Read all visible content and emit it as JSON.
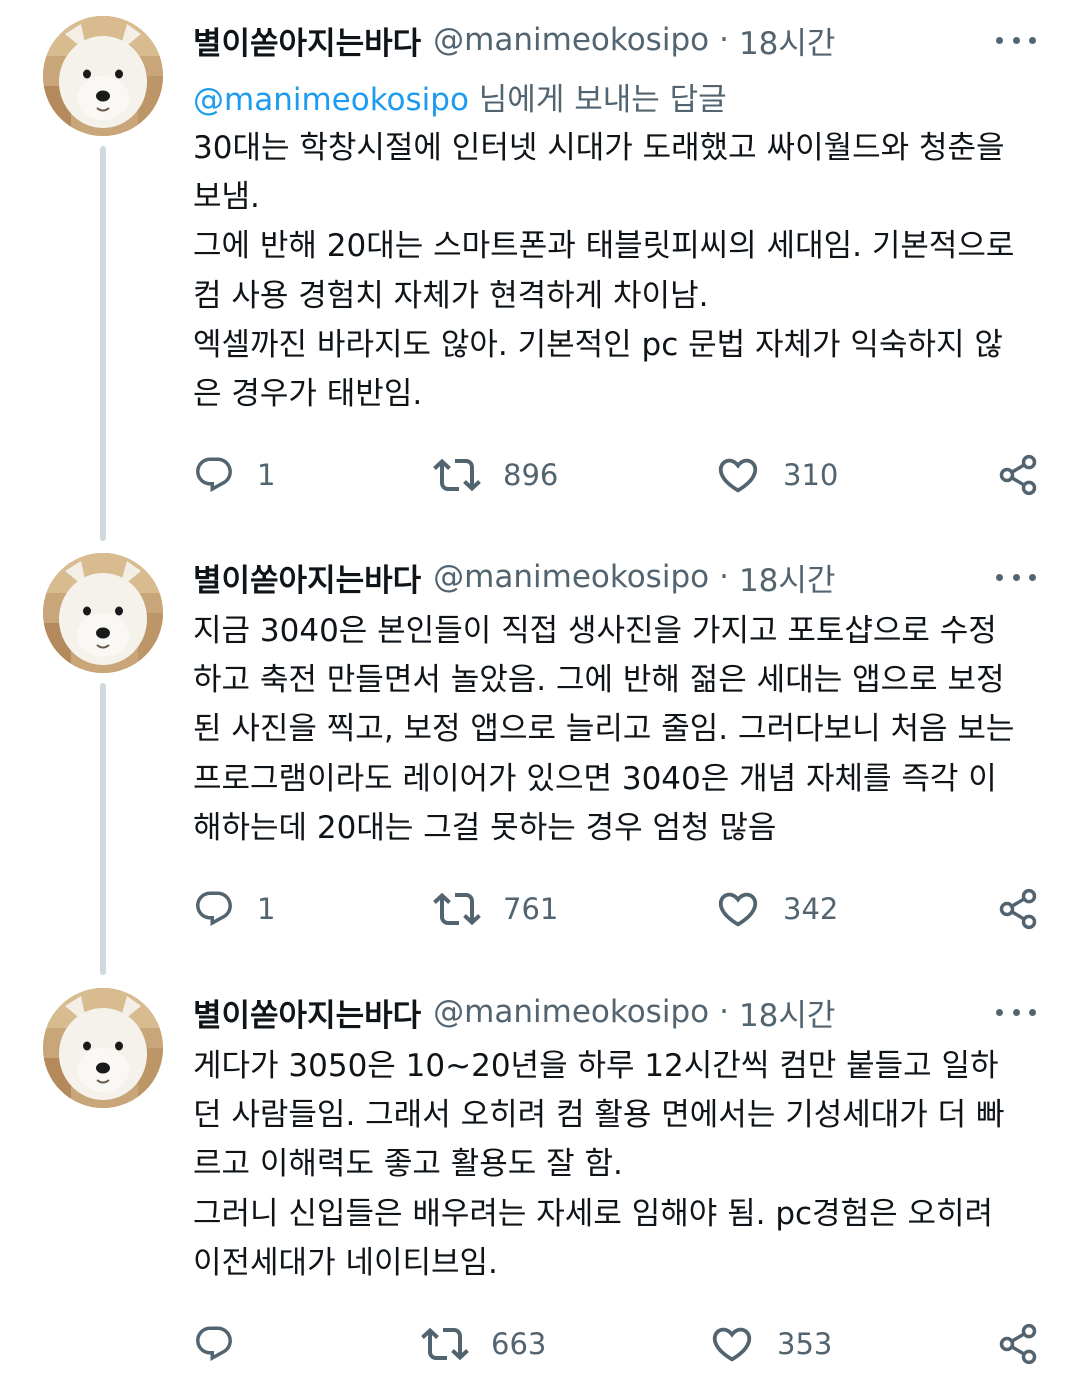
{
  "tweets": [
    {
      "name": "별이쏟아지는바다",
      "handle": "@manimeokosipo",
      "separator": "·",
      "time": "18시간",
      "reply_mention": "@manimeokosipo",
      "reply_suffix": " 님에게 보내는 답글",
      "lines": [
        "30대는 학창시절에 인터넷 시대가 도래했고 싸이월드와 청춘을",
        "보냄.",
        "그에 반해 20대는 스마트폰과 태블릿피씨의 세대임. 기본적으로",
        "컴 사용 경험치 자체가 현격하게 차이남.",
        "엑셀까진 바라지도 않아. 기본적인 pc 문법 자체가 익숙하지 않",
        "은 경우가 태반임."
      ],
      "replies": "1",
      "retweets": "896",
      "likes": "310"
    },
    {
      "name": "별이쏟아지는바다",
      "handle": "@manimeokosipo",
      "separator": "·",
      "time": "18시간",
      "lines": [
        "지금 3040은 본인들이 직접 생사진을 가지고 포토샵으로 수정",
        "하고 축전 만들면서 놀았음. 그에 반해 젊은 세대는 앱으로 보정",
        "된 사진을 찍고, 보정 앱으로 늘리고 줄임. 그러다보니 처음 보는",
        "프로그램이라도 레이어가 있으면 3040은 개념 자체를 즉각 이",
        "해하는데 20대는 그걸 못하는 경우 엄청 많음"
      ],
      "replies": "1",
      "retweets": "761",
      "likes": "342"
    },
    {
      "name": "별이쏟아지는바다",
      "handle": "@manimeokosipo",
      "separator": "·",
      "time": "18시간",
      "lines": [
        "게다가 3050은 10~20년을 하루 12시간씩 컴만 붙들고 일하",
        "던 사람들임. 그래서 오히려 컴 활용 면에서는 기성세대가 더 빠",
        "르고 이해력도 좋고 활용도 잘 함.",
        "그러니 신입들은 배우려는 자세로 임해야 됨. pc경험은 오히려",
        "이전세대가 네이티브임."
      ],
      "replies": "",
      "retweets": "663",
      "likes": "353"
    }
  ],
  "icons": {
    "reply": "reply-icon",
    "retweet": "retweet-icon",
    "like": "heart-icon",
    "share": "share-icon",
    "more": "more-icon"
  },
  "colors": {
    "text": "#0f1419",
    "secondary": "#536471",
    "link": "#1d9bf0",
    "thread_line": "#cfd9de"
  }
}
